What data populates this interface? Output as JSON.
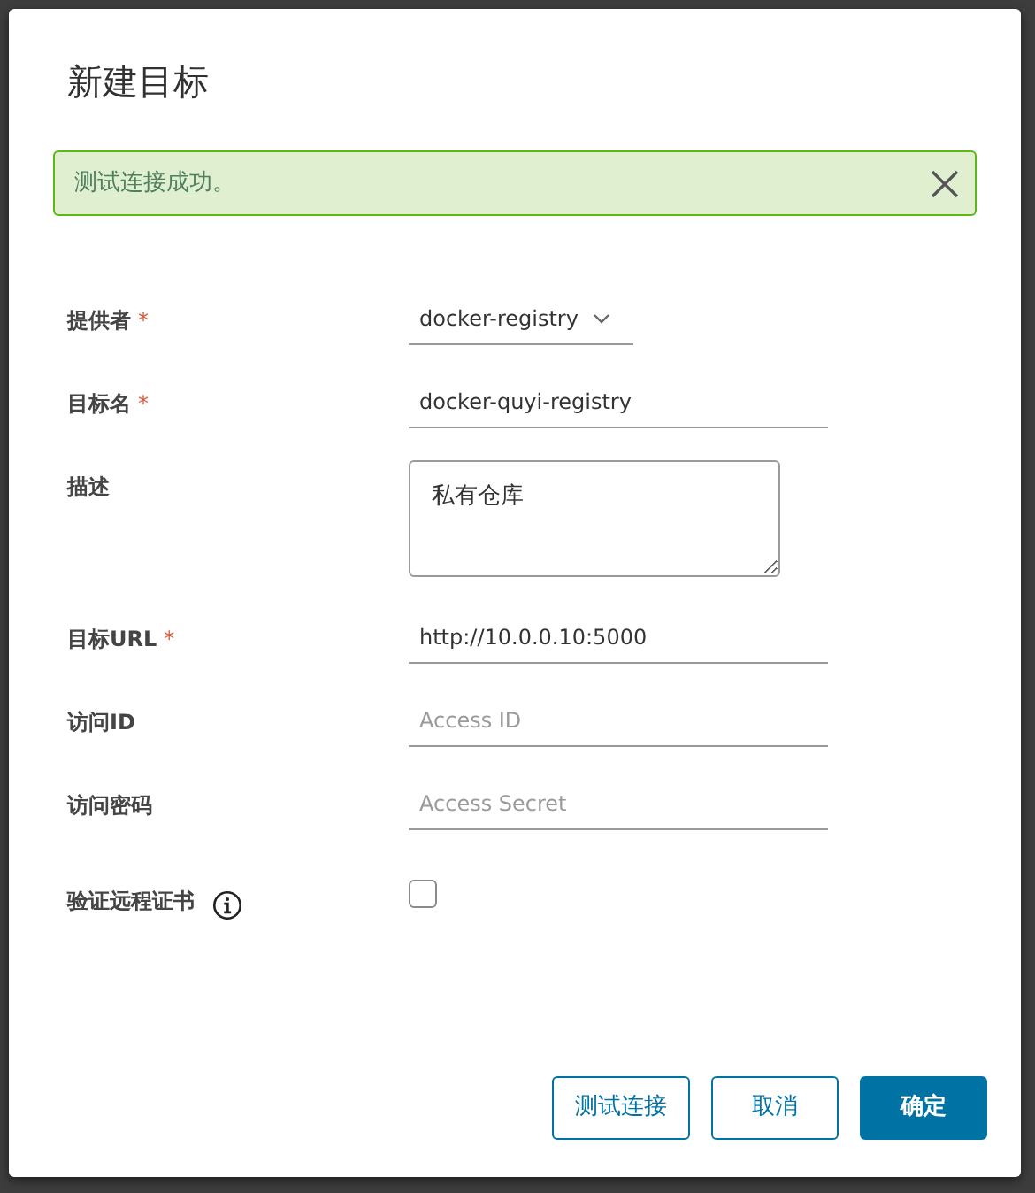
{
  "dialog": {
    "title": "新建目标"
  },
  "alert": {
    "text": "测试连接成功。"
  },
  "fields": [
    {
      "kind": "select",
      "label": "提供者",
      "required_mark": "*",
      "value": "docker-registry"
    },
    {
      "kind": "input",
      "label": "目标名",
      "required_mark": "*",
      "value": "docker-quyi-registry"
    },
    {
      "kind": "textarea",
      "label": "描述",
      "value": "私有仓库"
    },
    {
      "kind": "input",
      "label": "目标URL",
      "required_mark": "*",
      "value": "http://10.0.0.10:5000"
    },
    {
      "kind": "input",
      "label": "访问ID",
      "placeholder": "Access ID"
    },
    {
      "kind": "input",
      "label": "访问密码",
      "placeholder": "Access Secret"
    },
    {
      "kind": "checkbox",
      "label": "验证远程证书",
      "info": true,
      "checked": false
    }
  ],
  "buttons": [
    {
      "label": "测试连接",
      "kind": "outline"
    },
    {
      "label": "取消",
      "kind": "outline"
    },
    {
      "label": "确定",
      "kind": "primary"
    }
  ]
}
